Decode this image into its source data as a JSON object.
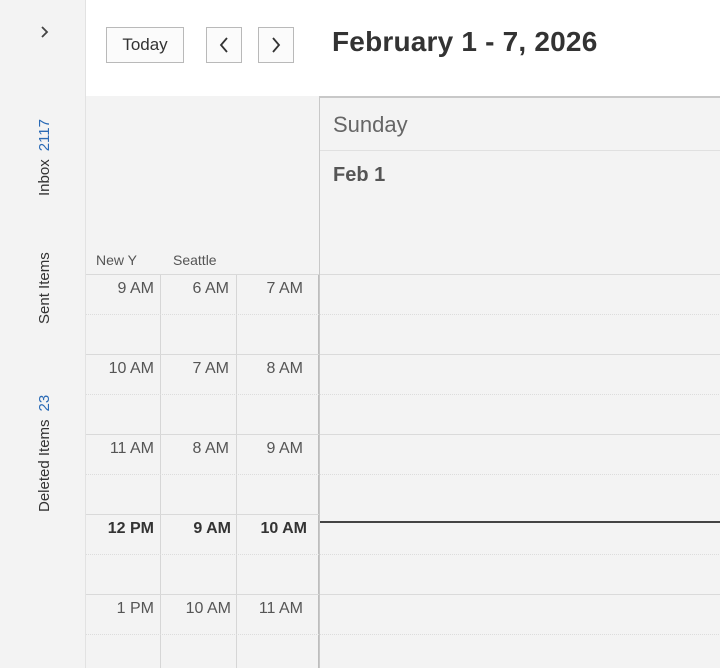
{
  "sidebar": {
    "expand_icon": "chevron-right-icon",
    "folders": [
      {
        "name": "Inbox",
        "count": "2117"
      },
      {
        "name": "Sent Items",
        "count": ""
      },
      {
        "name": "Deleted Items",
        "count": "23"
      }
    ]
  },
  "toolbar": {
    "today_label": "Today",
    "prev_icon": "chevron-left-icon",
    "next_icon": "chevron-right-icon",
    "range_title": "February 1 - 7, 2026"
  },
  "timezones": {
    "labels": [
      "New Y",
      "Seattle",
      ""
    ],
    "rows": [
      {
        "times": [
          "9 AM",
          "6 AM",
          "7 AM"
        ],
        "bold": false
      },
      {
        "times": [
          "10 AM",
          "7 AM",
          "8 AM"
        ],
        "bold": false
      },
      {
        "times": [
          "11 AM",
          "8 AM",
          "9 AM"
        ],
        "bold": false
      },
      {
        "times": [
          "12 PM",
          "9 AM",
          "10 AM"
        ],
        "bold": true
      },
      {
        "times": [
          "1 PM",
          "10 AM",
          "11 AM"
        ],
        "bold": false
      }
    ]
  },
  "day": {
    "name": "Sunday",
    "date": "Feb 1"
  },
  "colors": {
    "accent_count": "#2a6ab5",
    "background": "#f3f3f3",
    "now_line": "#444444"
  }
}
